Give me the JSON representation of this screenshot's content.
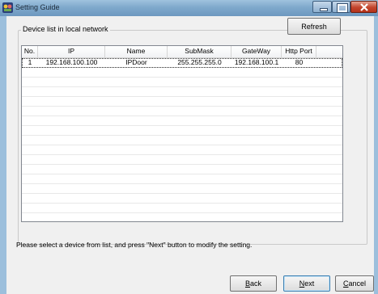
{
  "window": {
    "title": "Setting Guide"
  },
  "group": {
    "label": "Device list in local network"
  },
  "refresh_button": {
    "label": "Refresh"
  },
  "table": {
    "columns": [
      "No.",
      "IP",
      "Name",
      "SubMask",
      "GateWay",
      "Http Port"
    ],
    "rows": [
      {
        "no": "1",
        "ip": "192.168.100.100",
        "name": "IPDoor",
        "submask": "255.255.255.0",
        "gateway": "192.168.100.1",
        "http_port": "80"
      }
    ]
  },
  "hint": {
    "text": "Please select a device from list, and press \"Next\" button to modify the setting."
  },
  "buttons": {
    "back": {
      "accel": "B",
      "rest": "ack"
    },
    "next": {
      "accel": "N",
      "rest": "ext"
    },
    "cancel": {
      "accel": "C",
      "rest": "ancel"
    }
  },
  "colors": {
    "titlebar": "#7fa9cc",
    "close_button": "#c3442c",
    "panel": "#f0f0f0"
  }
}
